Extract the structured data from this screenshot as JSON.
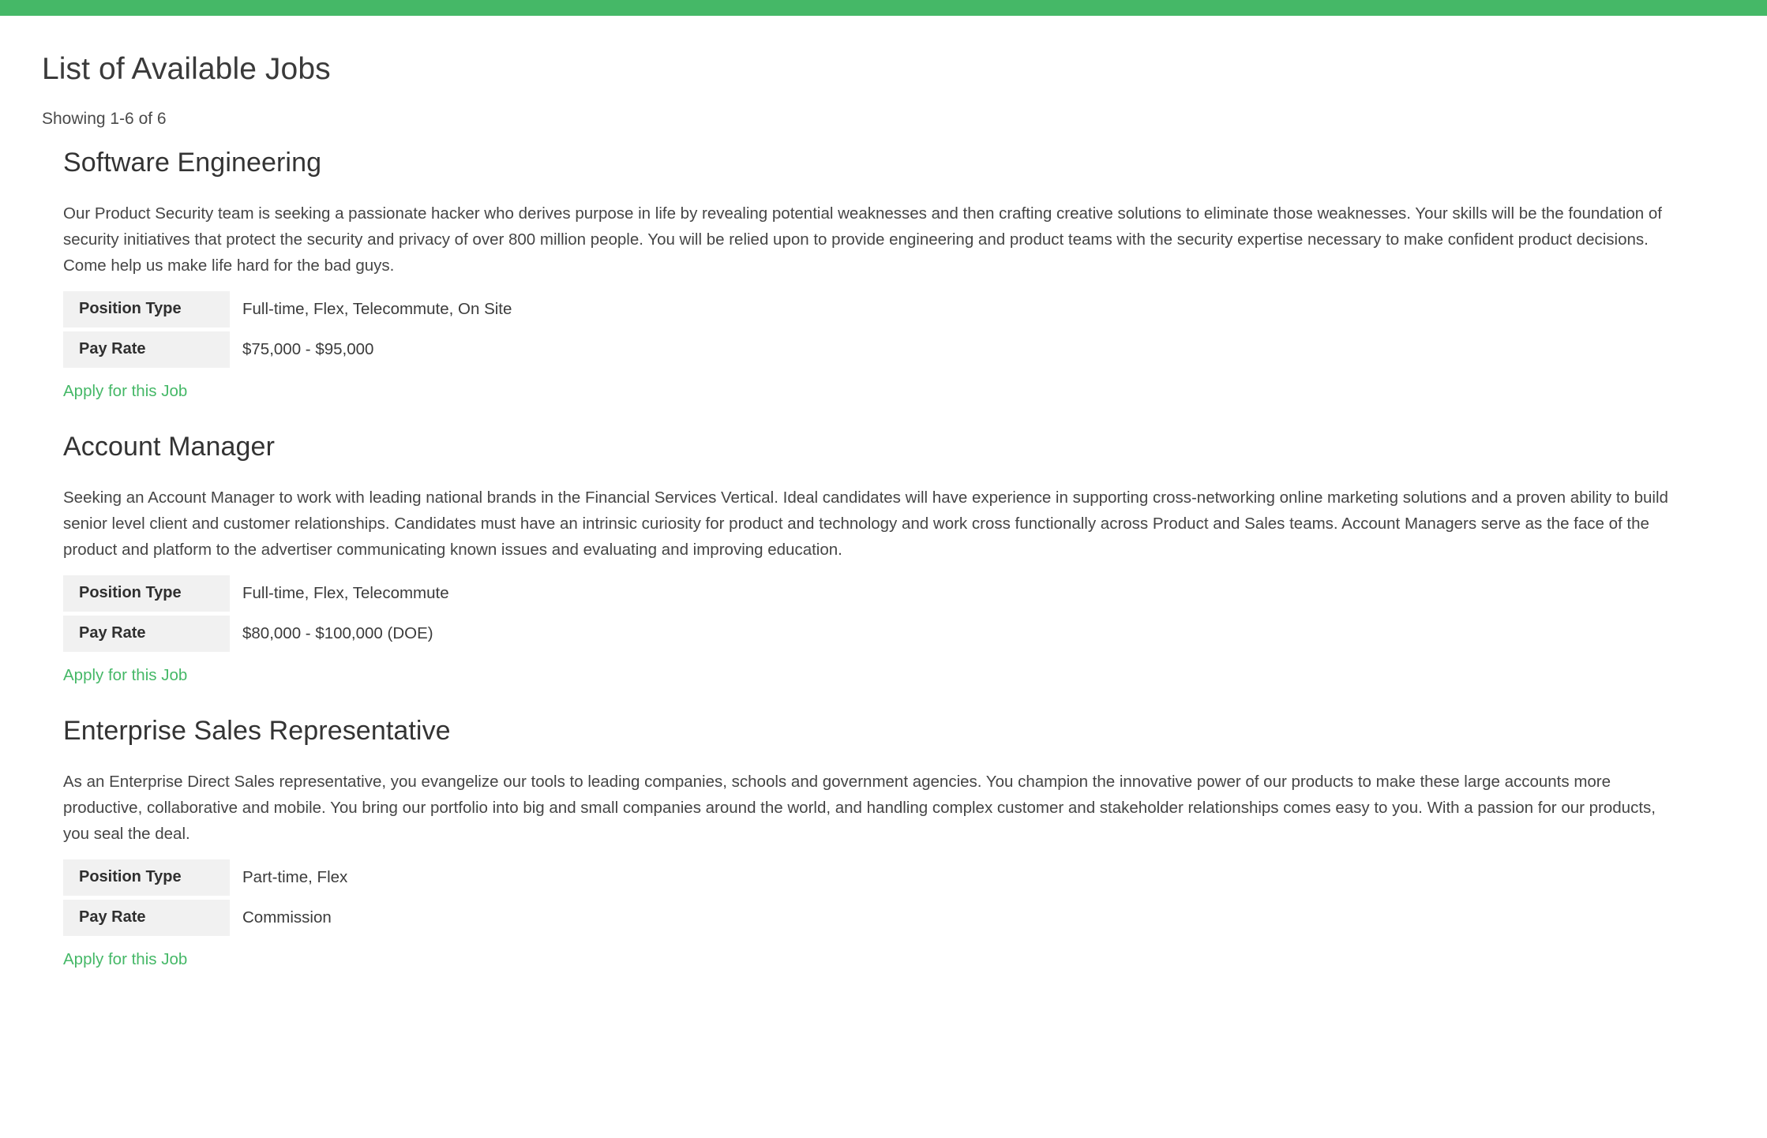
{
  "top_bar": {
    "color": "#45b867"
  },
  "accent_color": "#45b867",
  "header": {
    "title": "List of Available Jobs",
    "showing": "Showing 1-6 of 6"
  },
  "table_labels": {
    "position_type": "Position Type",
    "pay_rate": "Pay Rate"
  },
  "apply_label": "Apply for this Job",
  "jobs": [
    {
      "title": "Software Engineering",
      "description": "Our Product Security team is seeking a passionate hacker who derives purpose in life by revealing potential weaknesses and then crafting creative solutions to eliminate those weaknesses. Your skills will be the foundation of security initiatives that protect the security and privacy of over 800 million people. You will be relied upon to provide engineering and product teams with the security expertise necessary to make confident product decisions. Come help us make life hard for the bad guys.",
      "position_type": "Full-time, Flex, Telecommute, On Site",
      "pay_rate": "$75,000 - $95,000",
      "apply_label": "Apply for this Job"
    },
    {
      "title": "Account Manager",
      "description": "Seeking an Account Manager to work with leading national brands in the Financial Services Vertical. Ideal candidates will have experience in supporting cross-networking online marketing solutions and a proven ability to build senior level client and customer relationships. Candidates must have an intrinsic curiosity for product and technology and work cross functionally across Product and Sales teams. Account Managers serve as the face of the product and platform to the advertiser communicating known issues and evaluating and improving education.",
      "position_type": "Full-time, Flex, Telecommute",
      "pay_rate": "$80,000 - $100,000 (DOE)",
      "apply_label": "Apply for this Job"
    },
    {
      "title": "Enterprise Sales Representative",
      "description": "As an Enterprise Direct Sales representative, you evangelize our tools to leading companies, schools and government agencies. You champion the innovative power of our products to make these large accounts more productive, collaborative and mobile. You bring our portfolio into big and small companies around the world, and handling complex customer and stakeholder relationships comes easy to you. With a passion for our products, you seal the deal.",
      "position_type": "Part-time, Flex",
      "pay_rate": "Commission",
      "apply_label": "Apply for this Job"
    }
  ]
}
